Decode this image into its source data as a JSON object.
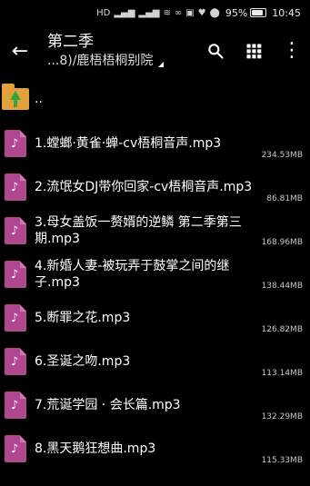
{
  "status_bar": {
    "icons": [
      "hd-icon",
      "signal-icon",
      "signal-icon",
      "wifi-icon",
      "link-icon",
      "app-icon",
      "heart-icon",
      "location-icon"
    ],
    "battery_percent": "95%",
    "time": "10:45"
  },
  "header": {
    "title": "第二季",
    "subtitle": "...8)/鹿梧梧桐别院"
  },
  "list": {
    "parent_label": "..",
    "files": [
      {
        "name": "1.螳螂·黄雀·蝉-cv梧桐音声.mp3",
        "size": "234.53MB"
      },
      {
        "name": "2.流氓女DJ带你回家-cv梧桐音声.mp3",
        "size": "86.81MB"
      },
      {
        "name": "3.母女盖饭一赘婿的逆鳞 第二季第三期.mp3",
        "size": "168.96MB"
      },
      {
        "name": "4.新婚人妻-被玩弄于鼓掌之间的继子.mp3",
        "size": "138.44MB"
      },
      {
        "name": "5.断罪之花.mp3",
        "size": "126.82MB"
      },
      {
        "name": "6.圣诞之吻.mp3",
        "size": "113.14MB"
      },
      {
        "name": "7.荒诞学园 · 会长篇.mp3",
        "size": "132.29MB"
      },
      {
        "name": "8.黑天鹅狂想曲.mp3",
        "size": "115.33MB"
      }
    ]
  }
}
